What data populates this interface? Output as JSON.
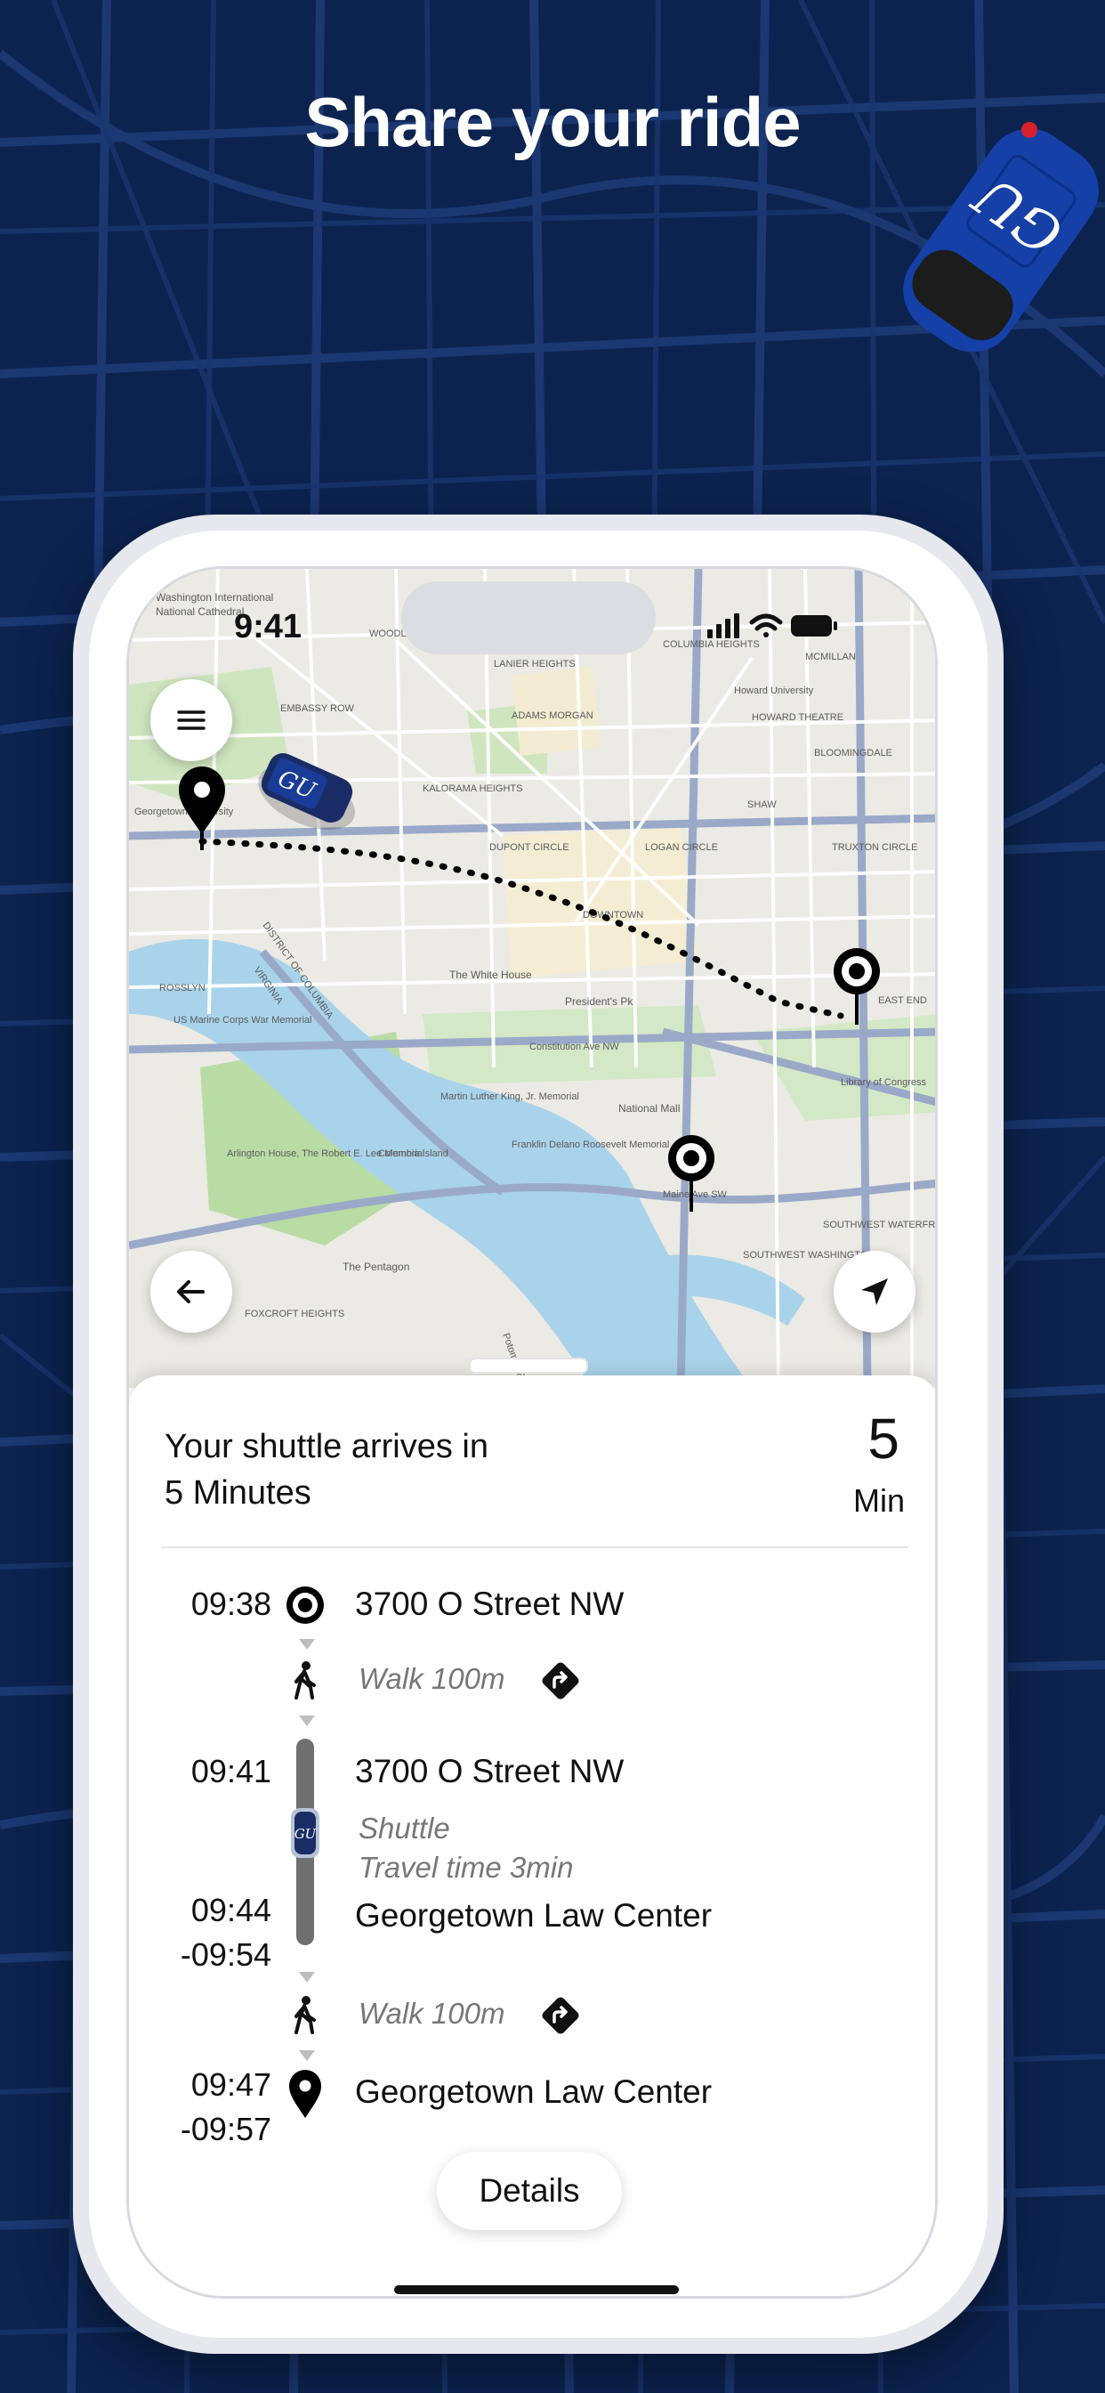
{
  "headline": "Share your ride",
  "status_bar": {
    "time": "9:41"
  },
  "map": {
    "labels": {
      "washington_intl": "Washington International",
      "national_cathedral": "National Cathedral",
      "woodley_park": "WOODLEY PARK",
      "lanier_heights": "LANIER HEIGHTS",
      "columbia_heights": "COLUMBIA HEIGHTS",
      "mcmillan": "MCMILLAN",
      "embassy_row": "EMBASSY ROW",
      "adams_morgan": "ADAMS MORGAN",
      "howard_university": "Howard University",
      "howard_theatre": "HOWARD THEATRE",
      "bloomingdale": "BLOOMINGDALE",
      "kalorama_heights": "KALORAMA HEIGHTS",
      "georgetown_university": "Georgetown University",
      "dupont_circle": "DUPONT CIRCLE",
      "logan_circle": "LOGAN CIRCLE",
      "shaw": "SHAW",
      "truxton_circle": "TRUXTON CIRCLE",
      "downtown": "DOWNTOWN",
      "district_of_columbia": "DISTRICT OF COLUMBIA",
      "virginia": "VIRGINIA",
      "rosslyn": "ROSSLYN",
      "white_house": "The White House",
      "presidents_park": "President's Pk",
      "east_end": "EAST END",
      "us_marine_corps": "US Marine Corps War Memorial",
      "constitution_ave": "Constitution Ave NW",
      "national_mall": "National Mall",
      "library_of_congress": "Library of Congress",
      "mlk_memorial": "Martin Luther King, Jr. Memorial",
      "arlington_house": "Arlington House, The Robert E. Lee Memorial",
      "columbia_island": "Columbia Island",
      "fdr_memorial": "Franklin Delano Roosevelt Memorial",
      "southwest_waterfront": "SOUTHWEST WATERFRONT",
      "southwest_washington": "SOUTHWEST WASHINGTON",
      "pentagon": "The Pentagon",
      "foxcroft_heights": "FOXCROFT HEIGHTS",
      "potomac_river": "Potomac River",
      "maine_ave": "Maine Ave SW"
    },
    "car_badge": "GU",
    "route_color": "#000000"
  },
  "sheet": {
    "arrive_line1": "Your shuttle arrives in",
    "arrive_line2": "5 Minutes",
    "minutes_value": "5",
    "minutes_unit": "Min",
    "steps": {
      "origin_time": "09:38",
      "origin_name": "3700 O Street NW",
      "walk1": "Walk 100m",
      "board_time": "09:41",
      "board_name": "3700 O Street NW",
      "shuttle_label": "Shuttle",
      "travel_time": "Travel time 3min",
      "alight_time": "09:44",
      "alight_window": "-09:54",
      "alight_name": "Georgetown Law Center",
      "walk2": "Walk 100m",
      "dest_time": "09:47",
      "dest_window": "-09:57",
      "dest_name": "Georgetown Law Center"
    },
    "details_label": "Details"
  },
  "colors": {
    "background": "#0c2350",
    "shuttle_blue": "#1540a8",
    "accent_red": "#d8202a"
  },
  "icons": {
    "menu": "hamburger-menu-icon",
    "back": "arrow-left-icon",
    "locate": "location-arrow-icon",
    "origin": "target-icon",
    "walk": "walking-person-icon",
    "directions": "directions-diamond-icon",
    "destination": "map-pin-icon"
  }
}
